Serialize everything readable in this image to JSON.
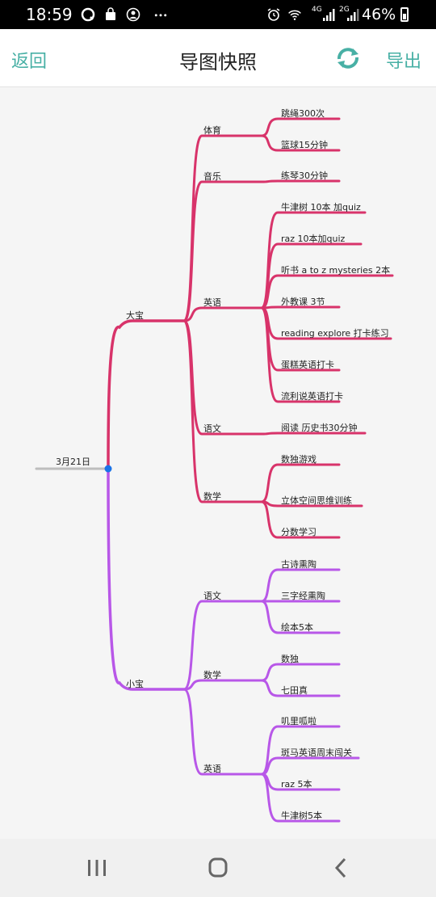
{
  "status_bar": {
    "time": "18:59",
    "battery": "46%",
    "network_4g": "4G",
    "network_2g": "2G"
  },
  "header": {
    "back_label": "返回",
    "title": "导图快照",
    "export_label": "导出",
    "accent_color": "#48b0a5"
  },
  "colors": {
    "branch_pink": "#d8336a",
    "branch_purple": "#b857e8",
    "root_line": "#bdbdbd",
    "root_dot": "#1a73e8"
  },
  "mindmap": {
    "root": "3月21日",
    "children": [
      {
        "label": "大宝",
        "color": "pink",
        "children": [
          {
            "label": "体育",
            "items": [
              "跳绳300次",
              "篮球15分钟"
            ]
          },
          {
            "label": "音乐",
            "items": [
              "练琴30分钟"
            ]
          },
          {
            "label": "英语",
            "items": [
              "牛津树 10本 加quiz",
              "raz 10本加quiz",
              "听书  a to z mysteries 2本",
              "外教课 3节",
              "reading explore 打卡练习",
              "蛋糕英语打卡",
              "流利说英语打卡"
            ]
          },
          {
            "label": "语文",
            "items": [
              "阅读 历史书30分钟"
            ]
          },
          {
            "label": "数学",
            "items": [
              "数独游戏",
              "立体空间思维训练",
              "分数学习"
            ]
          }
        ]
      },
      {
        "label": "小宝",
        "color": "purple",
        "children": [
          {
            "label": "语文",
            "items": [
              "古诗熏陶",
              "三字经熏陶",
              "绘本5本"
            ]
          },
          {
            "label": "数学",
            "items": [
              "数独",
              "七田真"
            ]
          },
          {
            "label": "英语",
            "items": [
              "叽里呱啦",
              "斑马英语周末闯关",
              "raz 5本",
              "牛津树5本"
            ]
          }
        ]
      }
    ]
  }
}
